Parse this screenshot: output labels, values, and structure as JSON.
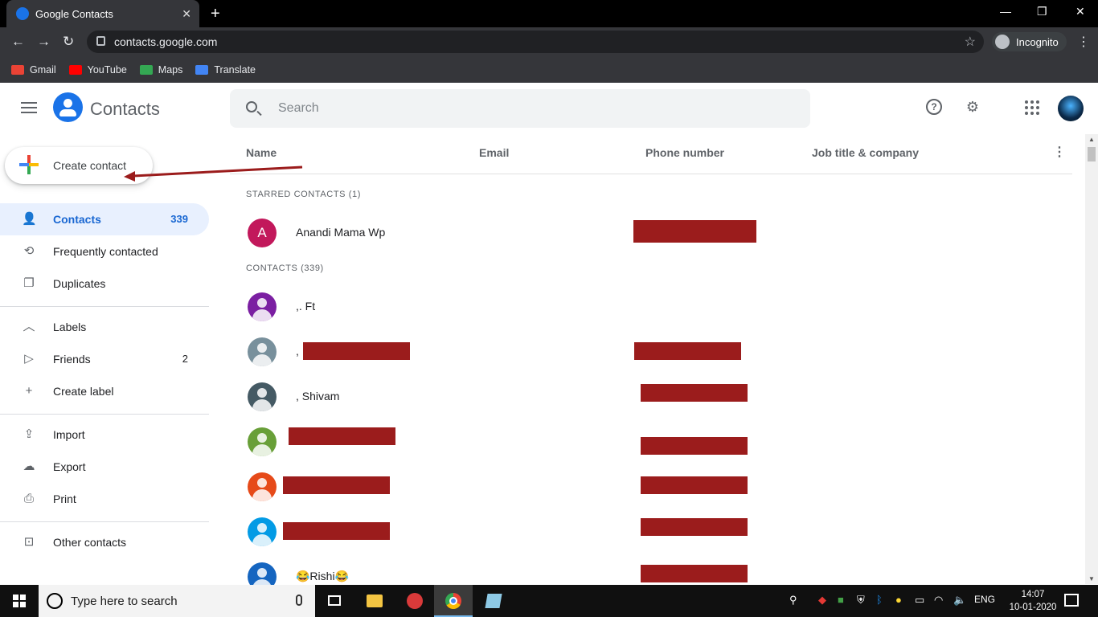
{
  "browser": {
    "tab_title": "Google Contacts",
    "url": "contacts.google.com",
    "profile_label": "Incognito",
    "bookmarks": [
      "Gmail",
      "YouTube",
      "Maps",
      "Translate"
    ]
  },
  "app": {
    "title": "Contacts",
    "search_placeholder": "Search"
  },
  "sidebar": {
    "create_label": "Create contact",
    "items": [
      {
        "label": "Contacts",
        "count": "339"
      },
      {
        "label": "Frequently contacted",
        "count": ""
      },
      {
        "label": "Duplicates",
        "count": ""
      },
      {
        "label": "Labels",
        "count": ""
      },
      {
        "label": "Friends",
        "count": "2"
      },
      {
        "label": "Create label",
        "count": ""
      },
      {
        "label": "Import",
        "count": ""
      },
      {
        "label": "Export",
        "count": ""
      },
      {
        "label": "Print",
        "count": ""
      },
      {
        "label": "Other contacts",
        "count": ""
      }
    ]
  },
  "list": {
    "columns": [
      "Name",
      "Email",
      "Phone number",
      "Job title & company"
    ],
    "starred_header": "STARRED CONTACTS (1)",
    "contacts_header": "CONTACTS (339)",
    "rows": [
      {
        "name": "Anandi Mama Wp",
        "avatar_color": "#c2185b",
        "initial": "A"
      },
      {
        "name": ",. Ft",
        "avatar_color": "#7b1fa2",
        "initial": ""
      },
      {
        "name": ", ",
        "avatar_color": "#78909c",
        "initial": ""
      },
      {
        "name": ", Shivam",
        "avatar_color": "#455a64",
        "initial": ""
      },
      {
        "name": "",
        "avatar_color": "#689f38",
        "initial": ""
      },
      {
        "name": "",
        "avatar_color": "#e64a19",
        "initial": ""
      },
      {
        "name": "",
        "avatar_color": "#039be5",
        "initial": ""
      },
      {
        "name": "😂Rishi😂",
        "avatar_color": "#1565c0",
        "initial": ""
      }
    ]
  },
  "taskbar": {
    "search_placeholder": "Type here to search",
    "language": "ENG",
    "time": "14:07",
    "date": "10-01-2020"
  },
  "colors": {
    "accent": "#1a73e8",
    "redaction": "#9b1c1c"
  }
}
